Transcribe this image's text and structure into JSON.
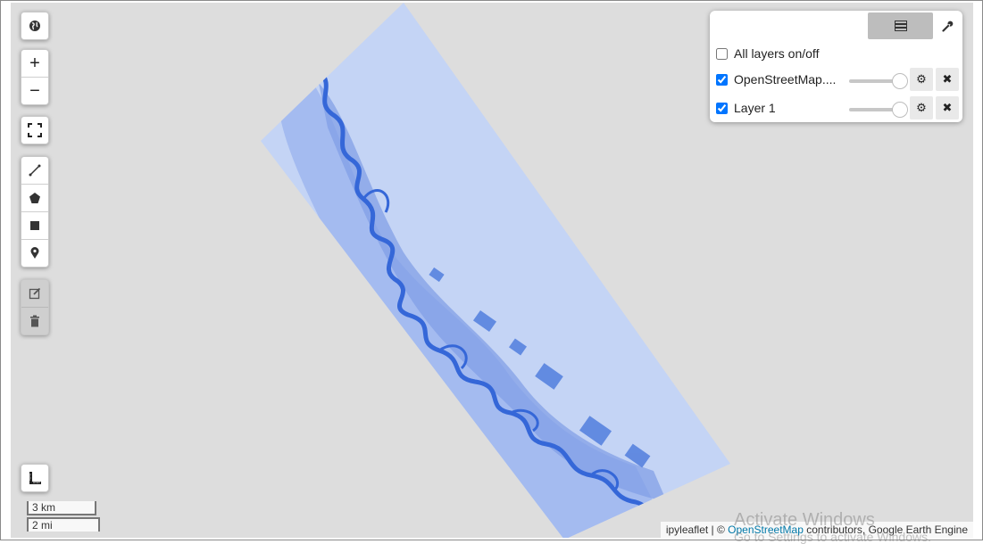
{
  "map": {
    "colors": {
      "background": "#dddddd",
      "raster_light": "#c4d4f5",
      "raster_mid": "#8fa9ea",
      "river": "#3567d8"
    }
  },
  "controls": {
    "globe_icon": "globe-icon",
    "zoom_in": "+",
    "zoom_out": "−",
    "fullscreen_icon": "fullscreen-icon",
    "draw_tools": [
      "polyline-icon",
      "polygon-icon",
      "rectangle-icon",
      "marker-icon"
    ],
    "edit_tools": [
      "edit-icon",
      "trash-icon"
    ],
    "measure_icon": "ruler-icon"
  },
  "layers_panel": {
    "all_layers_label": "All layers on/off",
    "all_layers_checked": false,
    "layers": [
      {
        "name": "OpenStreetMap....",
        "checked": true,
        "opacity": 1
      },
      {
        "name": "Layer 1",
        "checked": true,
        "opacity": 1
      }
    ]
  },
  "scale": {
    "metric": "3 km",
    "imperial": "2 mi"
  },
  "attribution": {
    "prefix": "ipyleaflet | © ",
    "link": "OpenStreetMap",
    "suffix": " contributors, Google Earth Engine"
  },
  "os_overlay": {
    "title": "Activate Windows",
    "subtitle": "Go to Settings to activate Windows."
  }
}
